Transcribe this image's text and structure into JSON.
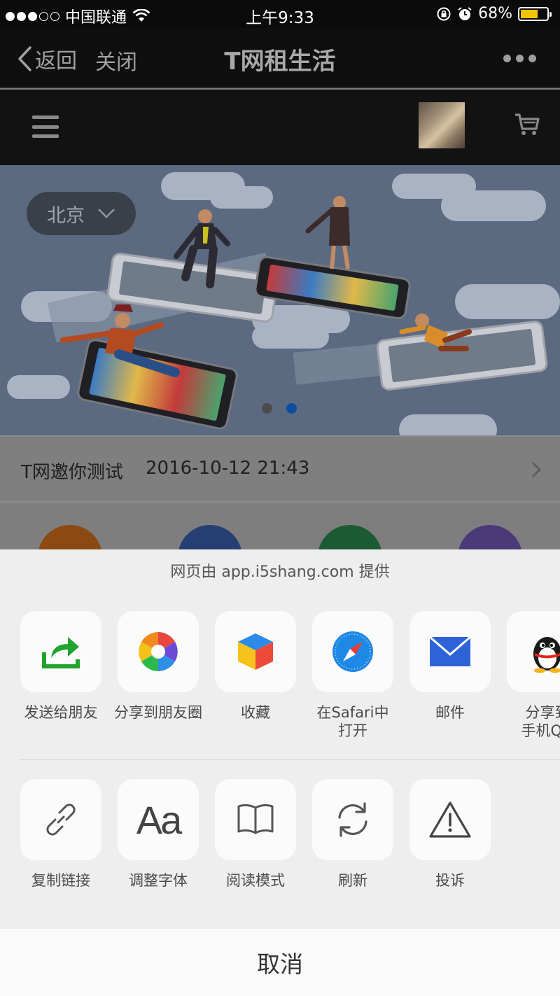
{
  "status_bar": {
    "carrier": "中国联通",
    "time": "上午9:33",
    "battery": "68%",
    "battery_level": 0.68,
    "signal_bars": 3,
    "signal_total": 5
  },
  "nav": {
    "back_label": "返回",
    "close_label": "关闭",
    "title": "T网租生活"
  },
  "banner": {
    "city": "北京",
    "page_count": 2,
    "active_page": 2
  },
  "notice": {
    "title": "T网邀你测试",
    "time": "2016-10-12 21:43"
  },
  "categories": [
    {
      "color": "#8a4a12"
    },
    {
      "color": "#263f73"
    },
    {
      "color": "#1b5a33"
    },
    {
      "color": "#4a3a7a"
    }
  ],
  "share_sheet": {
    "provider": "网页由 app.i5shang.com 提供",
    "row1": [
      {
        "id": "send-to-friend",
        "label": "发送给朋友",
        "label2": ""
      },
      {
        "id": "share-moments",
        "label": "分享到朋友圈",
        "label2": ""
      },
      {
        "id": "favorite",
        "label": "收藏",
        "label2": ""
      },
      {
        "id": "open-safari",
        "label": "在Safari中",
        "label2": "打开"
      },
      {
        "id": "mail",
        "label": "邮件",
        "label2": ""
      },
      {
        "id": "share-qq",
        "label": "分享到",
        "label2": "手机QQ"
      }
    ],
    "row2": [
      {
        "id": "copy-link",
        "label": "复制链接"
      },
      {
        "id": "font-size",
        "label": "调整字体"
      },
      {
        "id": "reading-mode",
        "label": "阅读模式"
      },
      {
        "id": "refresh",
        "label": "刷新"
      },
      {
        "id": "report",
        "label": "投诉"
      }
    ],
    "font_glyph": "Aa",
    "cancel": "取消"
  },
  "colors": {
    "wechat_green": "#21a32e",
    "safari_blue": "#1e88e5",
    "mail_blue": "#2d63d6",
    "battery_yellow": "#f5c400",
    "pager_active": "#0b4ea0"
  }
}
